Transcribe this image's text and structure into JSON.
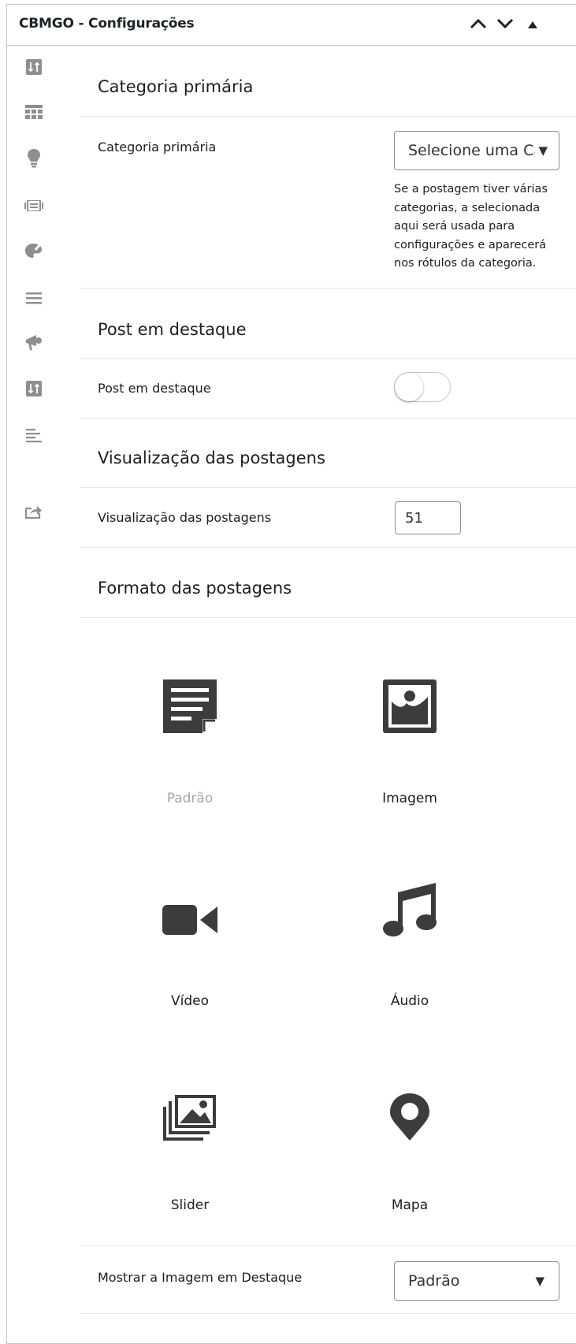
{
  "header": {
    "title": "CBMGO - Configurações"
  },
  "sections": {
    "primary_category": {
      "title": "Categoria primária",
      "label": "Categoria primária",
      "select_value": "Selecione uma Ca",
      "help": "Se a postagem tiver várias categorias, a selecionada aqui será usada para configurações e aparecerá nos rótulos da categoria."
    },
    "featured": {
      "title": "Post em destaque",
      "label": "Post em destaque",
      "toggle_on": false
    },
    "views": {
      "title": "Visualização das postagens",
      "label": "Visualização das postagens",
      "value": "51"
    },
    "format": {
      "title": "Formato das postagens",
      "items": [
        {
          "label": "Padrão",
          "icon": "document-icon",
          "selected": true
        },
        {
          "label": "Imagem",
          "icon": "image-icon",
          "selected": false
        },
        {
          "label": "Vídeo",
          "icon": "video-camera-icon",
          "selected": false
        },
        {
          "label": "Áudio",
          "icon": "music-note-icon",
          "selected": false
        },
        {
          "label": "Slider",
          "icon": "gallery-icon",
          "selected": false
        },
        {
          "label": "Mapa",
          "icon": "map-pin-icon",
          "selected": false
        }
      ]
    },
    "featured_image": {
      "label": "Mostrar a Imagem em Destaque",
      "select_value": "Padrão"
    }
  },
  "sidebar_icons": [
    "sort-icon",
    "layout-icon",
    "lightbulb-icon",
    "slides-icon",
    "palette-icon",
    "menu-icon",
    "megaphone-icon",
    "sort-icon",
    "align-left-icon",
    "share-icon"
  ],
  "colors": {
    "icon_dark": "#3c3c3c",
    "sidebar_icon": "#8c8f94",
    "border": "#c3c4c7",
    "muted_text": "#a7a7a7"
  }
}
